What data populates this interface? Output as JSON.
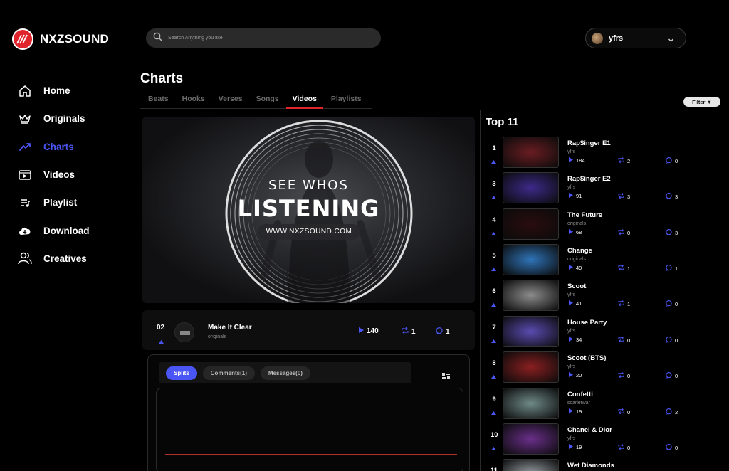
{
  "brand": {
    "name": "NXZSOUND"
  },
  "nav": [
    {
      "label": "Home",
      "icon": "home-icon",
      "active": false
    },
    {
      "label": "Originals",
      "icon": "crown-icon",
      "active": false
    },
    {
      "label": "Charts",
      "icon": "trending-icon",
      "active": true
    },
    {
      "label": "Videos",
      "icon": "video-icon",
      "active": false
    },
    {
      "label": "Playlist",
      "icon": "playlist-icon",
      "active": false
    },
    {
      "label": "Download",
      "icon": "cloud-download-icon",
      "active": false
    },
    {
      "label": "Creatives",
      "icon": "users-icon",
      "active": false
    }
  ],
  "search": {
    "placeholder": "Search Anything you like"
  },
  "user": {
    "name": "yfrs"
  },
  "main": {
    "title": "Charts",
    "tabs": [
      {
        "label": "Beats",
        "active": false
      },
      {
        "label": "Hooks",
        "active": false
      },
      {
        "label": "Verses",
        "active": false
      },
      {
        "label": "Songs",
        "active": false
      },
      {
        "label": "Videos",
        "active": true
      },
      {
        "label": "Playlists",
        "active": false
      }
    ],
    "hero": {
      "line1": "SEE WHOS",
      "line2": "LISTENING",
      "url": "WWW.NXZSOUND.COM"
    },
    "current_track": {
      "rank": "02",
      "title": "Make It Clear",
      "artist": "originals",
      "plays": "140",
      "reposts": "1",
      "comments": "1"
    },
    "panel_tabs": [
      {
        "label": "Splits",
        "active": true
      },
      {
        "label": "Comments(1)",
        "active": false
      },
      {
        "label": "Messages(0)",
        "active": false
      }
    ]
  },
  "top": {
    "title": "Top 11",
    "filter_label": "Filter ▼",
    "items": [
      {
        "rank": "1",
        "title": "Rap$inger E1",
        "artist": "yfrs",
        "plays": "184",
        "reposts": "2",
        "comments": "0",
        "color": "#6a1d22"
      },
      {
        "rank": "3",
        "title": "Rap$inger E2",
        "artist": "yfrs",
        "plays": "91",
        "reposts": "3",
        "comments": "3",
        "color": "#3d2a8a"
      },
      {
        "rank": "4",
        "title": "The Future",
        "artist": "originals",
        "plays": "68",
        "reposts": "0",
        "comments": "3",
        "color": "#2a0c0e"
      },
      {
        "rank": "5",
        "title": "Change",
        "artist": "originals",
        "plays": "49",
        "reposts": "1",
        "comments": "1",
        "color": "#2f74b8"
      },
      {
        "rank": "6",
        "title": "Scoot",
        "artist": "yfrs",
        "plays": "41",
        "reposts": "1",
        "comments": "0",
        "color": "#8c8c8c"
      },
      {
        "rank": "7",
        "title": "House Party",
        "artist": "yfrs",
        "plays": "34",
        "reposts": "0",
        "comments": "0",
        "color": "#5a4bb0"
      },
      {
        "rank": "8",
        "title": "Scoot (BTS)",
        "artist": "yfrs",
        "plays": "20",
        "reposts": "0",
        "comments": "0",
        "color": "#8a1f20"
      },
      {
        "rank": "9",
        "title": "Confetti",
        "artist": "scarletwar",
        "plays": "19",
        "reposts": "0",
        "comments": "2",
        "color": "#6f8a88"
      },
      {
        "rank": "10",
        "title": "Chanel & Dior",
        "artist": "yfrs",
        "plays": "19",
        "reposts": "0",
        "comments": "0",
        "color": "#6a2f8a"
      },
      {
        "rank": "11",
        "title": "Wet Diamonds",
        "artist": "",
        "plays": "",
        "reposts": "",
        "comments": "",
        "color": "#9aa2a8"
      }
    ]
  },
  "colors": {
    "accent": "#4a55f5",
    "brand_red": "#e0242b",
    "background": "#000000"
  }
}
